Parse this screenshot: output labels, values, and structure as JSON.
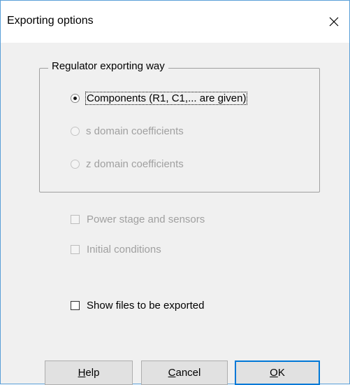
{
  "window": {
    "title": "Exporting options",
    "close_label": "×"
  },
  "group": {
    "label": "Regulator exporting way",
    "options": [
      {
        "label": "Components (R1, C1,... are given)",
        "selected": true,
        "enabled": true
      },
      {
        "label": "s domain coefficients",
        "selected": false,
        "enabled": false
      },
      {
        "label": "z domain coefficients",
        "selected": false,
        "enabled": false
      }
    ]
  },
  "checkboxes": [
    {
      "label": "Power stage and sensors",
      "checked": false,
      "enabled": false
    },
    {
      "label": "Initial conditions",
      "checked": false,
      "enabled": false
    },
    {
      "label": "Show files to be exported",
      "checked": false,
      "enabled": true
    }
  ],
  "buttons": {
    "help": {
      "mnemonic": "H",
      "rest": "elp"
    },
    "cancel": {
      "mnemonic": "C",
      "rest": "ancel"
    },
    "ok": {
      "mnemonic": "O",
      "rest": "K"
    }
  },
  "colors": {
    "accent": "#0078d7",
    "disabled_text": "#a0a0a0",
    "dialog_background": "#f0f0f0"
  }
}
